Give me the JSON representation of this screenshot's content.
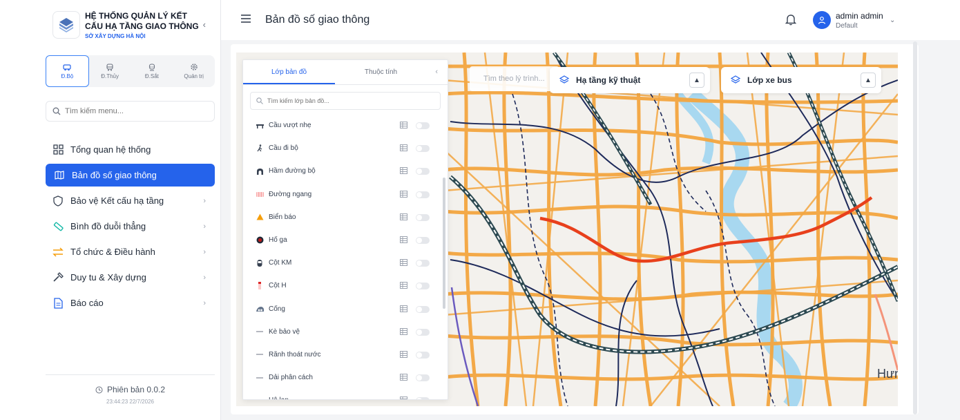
{
  "brand": {
    "title": "HỆ THỐNG QUẢN LÝ KẾT CẤU HẠ TẦNG GIAO THÔNG",
    "subtitle": "SỞ XÂY DỰNG HÀ NỘI"
  },
  "modes": [
    {
      "label": "Đ.Bộ",
      "icon": "car-icon",
      "active": true
    },
    {
      "label": "Đ.Thủy",
      "icon": "boat-icon",
      "active": false
    },
    {
      "label": "Đ.Sắt",
      "icon": "train-icon",
      "active": false
    },
    {
      "label": "Quản trị",
      "icon": "gear-icon",
      "active": false
    }
  ],
  "menu_search": {
    "placeholder": "Tìm kiếm menu..."
  },
  "menu": [
    {
      "label": "Tổng quan hệ thống",
      "icon": "dashboard-icon",
      "active": false,
      "has_children": false
    },
    {
      "label": "Bản đồ số giao thông",
      "icon": "map-icon",
      "active": true,
      "has_children": false
    },
    {
      "label": "Bảo vệ Kết cấu hạ tầng",
      "icon": "shield-icon",
      "active": false,
      "has_children": true
    },
    {
      "label": "Bình đồ duỗi thẳng",
      "icon": "ruler-icon",
      "active": false,
      "has_children": true
    },
    {
      "label": "Tổ chức & Điều hành",
      "icon": "swap-icon",
      "active": false,
      "has_children": true
    },
    {
      "label": "Duy tu & Xây dựng",
      "icon": "hammer-icon",
      "active": false,
      "has_children": true
    },
    {
      "label": "Báo cáo",
      "icon": "report-icon",
      "active": false,
      "has_children": true
    }
  ],
  "version": {
    "label": "Phiên bản 0.0.2",
    "timestamp": "23:44:23 22/7/2026"
  },
  "header": {
    "title": "Bản đồ số giao thông",
    "user_name": "admin admin",
    "user_role": "Default"
  },
  "layer_panel": {
    "tabs": [
      "Lớp bản đồ",
      "Thuộc tính"
    ],
    "search_placeholder": "Tìm kiếm lớp bản đồ...",
    "layers": [
      {
        "label": "Cầu vượt nhẹ",
        "icon": "bridge-icon"
      },
      {
        "label": "Cầu đi bộ",
        "icon": "pedestrian-icon"
      },
      {
        "label": "Hầm đường bộ",
        "icon": "tunnel-icon"
      },
      {
        "label": "Đường ngang",
        "icon": "crossing-icon"
      },
      {
        "label": "Biển báo",
        "icon": "warning-sign-icon"
      },
      {
        "label": "Hố ga",
        "icon": "manhole-icon"
      },
      {
        "label": "Cột KM",
        "icon": "km-post-icon"
      },
      {
        "label": "Cột H",
        "icon": "h-post-icon"
      },
      {
        "label": "Cống",
        "icon": "culvert-icon"
      },
      {
        "label": "Kè bảo vệ",
        "icon": "line-icon"
      },
      {
        "label": "Rãnh thoát nước",
        "icon": "line-icon"
      },
      {
        "label": "Dải phân cách",
        "icon": "line-icon"
      },
      {
        "label": "Hộ lan",
        "icon": "line-icon"
      }
    ]
  },
  "map": {
    "route_search_placeholder": "Tìm theo lý trình...",
    "dropdown_infra": "Hạ tầng kỹ thuật",
    "dropdown_bus": "Lớp xe bus",
    "label_hung": "Hưng"
  },
  "colors": {
    "primary": "#2563eb",
    "road": "#f4a640",
    "road_dark": "#1e2a5a",
    "river": "#a8d8f0",
    "route_highlight": "#e8401c"
  }
}
